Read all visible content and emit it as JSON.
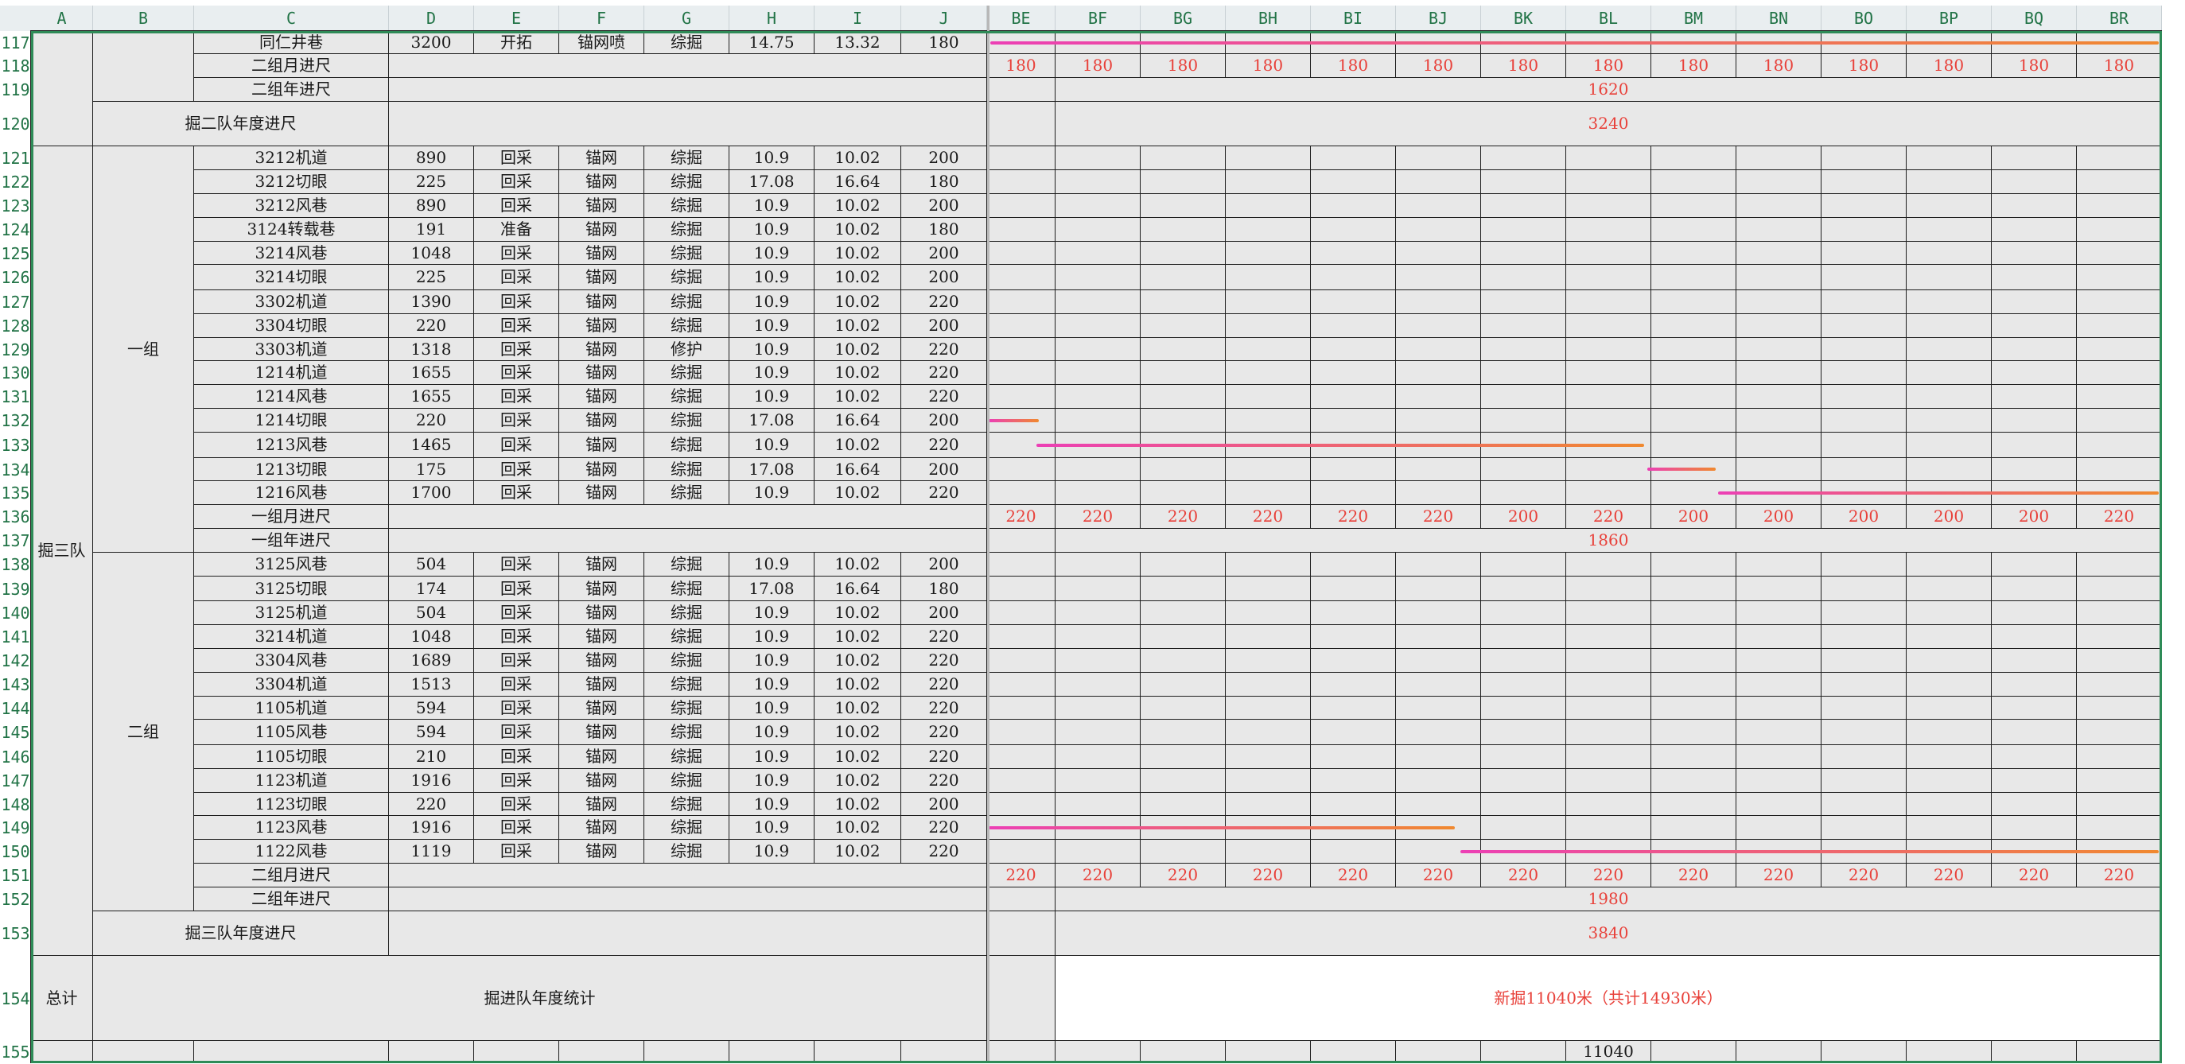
{
  "col_headers": [
    "A",
    "B",
    "C",
    "D",
    "E",
    "F",
    "G",
    "H",
    "I",
    "J",
    "BE",
    "BF",
    "BG",
    "BH",
    "BI",
    "BJ",
    "BK",
    "BL",
    "BM",
    "BN",
    "BO",
    "BP",
    "BQ",
    "BR"
  ],
  "row_numbers": [
    "117",
    "118",
    "119",
    "120",
    "121",
    "122",
    "123",
    "124",
    "125",
    "126",
    "127",
    "128",
    "129",
    "130",
    "131",
    "132",
    "133",
    "134",
    "135",
    "136",
    "137",
    "138",
    "139",
    "140",
    "141",
    "142",
    "143",
    "144",
    "145",
    "146",
    "147",
    "148",
    "149",
    "150",
    "151",
    "152",
    "153",
    "154",
    "155"
  ],
  "team3_label": "掘三队",
  "group1_label": "一组",
  "group2_label": "二组",
  "team2_annual_label": "掘二队年度进尺",
  "team3_annual_label": "掘三队年度进尺",
  "total_label": "总计",
  "stats_label": "掘进队年度统计",
  "top_row": {
    "name": "同仁井巷",
    "length": "3200",
    "type": "开拓",
    "support": "锚网喷",
    "method": "综掘",
    "h": "14.75",
    "i": "13.32",
    "j": "180"
  },
  "g2_month_label": "二组月进尺",
  "g2_year_label": "二组年进尺",
  "g1_month_label": "一组月进尺",
  "g1_year_label": "一组年进尺",
  "group1_rows": [
    {
      "name": "3212机道",
      "length": "890",
      "type": "回采",
      "support": "锚网",
      "method": "综掘",
      "h": "10.9",
      "i": "10.02",
      "j": "200"
    },
    {
      "name": "3212切眼",
      "length": "225",
      "type": "回采",
      "support": "锚网",
      "method": "综掘",
      "h": "17.08",
      "i": "16.64",
      "j": "180"
    },
    {
      "name": "3212风巷",
      "length": "890",
      "type": "回采",
      "support": "锚网",
      "method": "综掘",
      "h": "10.9",
      "i": "10.02",
      "j": "200"
    },
    {
      "name": "3124转载巷",
      "length": "191",
      "type": "准备",
      "support": "锚网",
      "method": "综掘",
      "h": "10.9",
      "i": "10.02",
      "j": "180"
    },
    {
      "name": "3214风巷",
      "length": "1048",
      "type": "回采",
      "support": "锚网",
      "method": "综掘",
      "h": "10.9",
      "i": "10.02",
      "j": "200"
    },
    {
      "name": "3214切眼",
      "length": "225",
      "type": "回采",
      "support": "锚网",
      "method": "综掘",
      "h": "10.9",
      "i": "10.02",
      "j": "200"
    },
    {
      "name": "3302机道",
      "length": "1390",
      "type": "回采",
      "support": "锚网",
      "method": "综掘",
      "h": "10.9",
      "i": "10.02",
      "j": "220"
    },
    {
      "name": "3304切眼",
      "length": "220",
      "type": "回采",
      "support": "锚网",
      "method": "综掘",
      "h": "10.9",
      "i": "10.02",
      "j": "200"
    },
    {
      "name": "3303机道",
      "length": "1318",
      "type": "回采",
      "support": "锚网",
      "method": "修护",
      "h": "10.9",
      "i": "10.02",
      "j": "220"
    },
    {
      "name": "1214机道",
      "length": "1655",
      "type": "回采",
      "support": "锚网",
      "method": "综掘",
      "h": "10.9",
      "i": "10.02",
      "j": "220"
    },
    {
      "name": "1214风巷",
      "length": "1655",
      "type": "回采",
      "support": "锚网",
      "method": "综掘",
      "h": "10.9",
      "i": "10.02",
      "j": "220"
    },
    {
      "name": "1214切眼",
      "length": "220",
      "type": "回采",
      "support": "锚网",
      "method": "综掘",
      "h": "17.08",
      "i": "16.64",
      "j": "200"
    },
    {
      "name": "1213风巷",
      "length": "1465",
      "type": "回采",
      "support": "锚网",
      "method": "综掘",
      "h": "10.9",
      "i": "10.02",
      "j": "220"
    },
    {
      "name": "1213切眼",
      "length": "175",
      "type": "回采",
      "support": "锚网",
      "method": "综掘",
      "h": "17.08",
      "i": "16.64",
      "j": "200"
    },
    {
      "name": "1216风巷",
      "length": "1700",
      "type": "回采",
      "support": "锚网",
      "method": "综掘",
      "h": "10.9",
      "i": "10.02",
      "j": "220"
    }
  ],
  "group2_rows": [
    {
      "name": "3125风巷",
      "length": "504",
      "type": "回采",
      "support": "锚网",
      "method": "综掘",
      "h": "10.9",
      "i": "10.02",
      "j": "200"
    },
    {
      "name": "3125切眼",
      "length": "174",
      "type": "回采",
      "support": "锚网",
      "method": "综掘",
      "h": "17.08",
      "i": "16.64",
      "j": "180"
    },
    {
      "name": "3125机道",
      "length": "504",
      "type": "回采",
      "support": "锚网",
      "method": "综掘",
      "h": "10.9",
      "i": "10.02",
      "j": "200"
    },
    {
      "name": "3214机道",
      "length": "1048",
      "type": "回采",
      "support": "锚网",
      "method": "综掘",
      "h": "10.9",
      "i": "10.02",
      "j": "220"
    },
    {
      "name": "3304风巷",
      "length": "1689",
      "type": "回采",
      "support": "锚网",
      "method": "综掘",
      "h": "10.9",
      "i": "10.02",
      "j": "220"
    },
    {
      "name": "3304机道",
      "length": "1513",
      "type": "回采",
      "support": "锚网",
      "method": "综掘",
      "h": "10.9",
      "i": "10.02",
      "j": "220"
    },
    {
      "name": "1105机道",
      "length": "594",
      "type": "回采",
      "support": "锚网",
      "method": "综掘",
      "h": "10.9",
      "i": "10.02",
      "j": "220"
    },
    {
      "name": "1105风巷",
      "length": "594",
      "type": "回采",
      "support": "锚网",
      "method": "综掘",
      "h": "10.9",
      "i": "10.02",
      "j": "220"
    },
    {
      "name": "1105切眼",
      "length": "210",
      "type": "回采",
      "support": "锚网",
      "method": "综掘",
      "h": "10.9",
      "i": "10.02",
      "j": "220"
    },
    {
      "name": "1123机道",
      "length": "1916",
      "type": "回采",
      "support": "锚网",
      "method": "综掘",
      "h": "10.9",
      "i": "10.02",
      "j": "220"
    },
    {
      "name": "1123切眼",
      "length": "220",
      "type": "回采",
      "support": "锚网",
      "method": "综掘",
      "h": "10.9",
      "i": "10.02",
      "j": "200"
    },
    {
      "name": "1123风巷",
      "length": "1916",
      "type": "回采",
      "support": "锚网",
      "method": "综掘",
      "h": "10.9",
      "i": "10.02",
      "j": "220"
    },
    {
      "name": "1122风巷",
      "length": "1119",
      "type": "回采",
      "support": "锚网",
      "method": "综掘",
      "h": "10.9",
      "i": "10.02",
      "j": "220"
    }
  ],
  "monthly_118": [
    "180",
    "180",
    "180",
    "180",
    "180",
    "180",
    "180",
    "180",
    "180",
    "180",
    "180",
    "180",
    "180",
    "180"
  ],
  "annual_119": "1620",
  "annual_120": "3240",
  "monthly_136": [
    "220",
    "220",
    "220",
    "220",
    "220",
    "220",
    "200",
    "220",
    "200",
    "200",
    "200",
    "200",
    "200",
    "220"
  ],
  "annual_137": "1860",
  "monthly_151": [
    "220",
    "220",
    "220",
    "220",
    "220",
    "220",
    "220",
    "220",
    "220",
    "220",
    "220",
    "220",
    "220",
    "220"
  ],
  "annual_152": "1980",
  "annual_153": "3840",
  "total_note": "新掘11040米（共计14930米）",
  "total_155": "11040",
  "colors": {
    "bar_start": "#ec3fb5",
    "bar_end": "#f0892f",
    "red_text": "#e8413a",
    "header_green": "#217346",
    "sheet_gray": "#e8e8e8"
  }
}
